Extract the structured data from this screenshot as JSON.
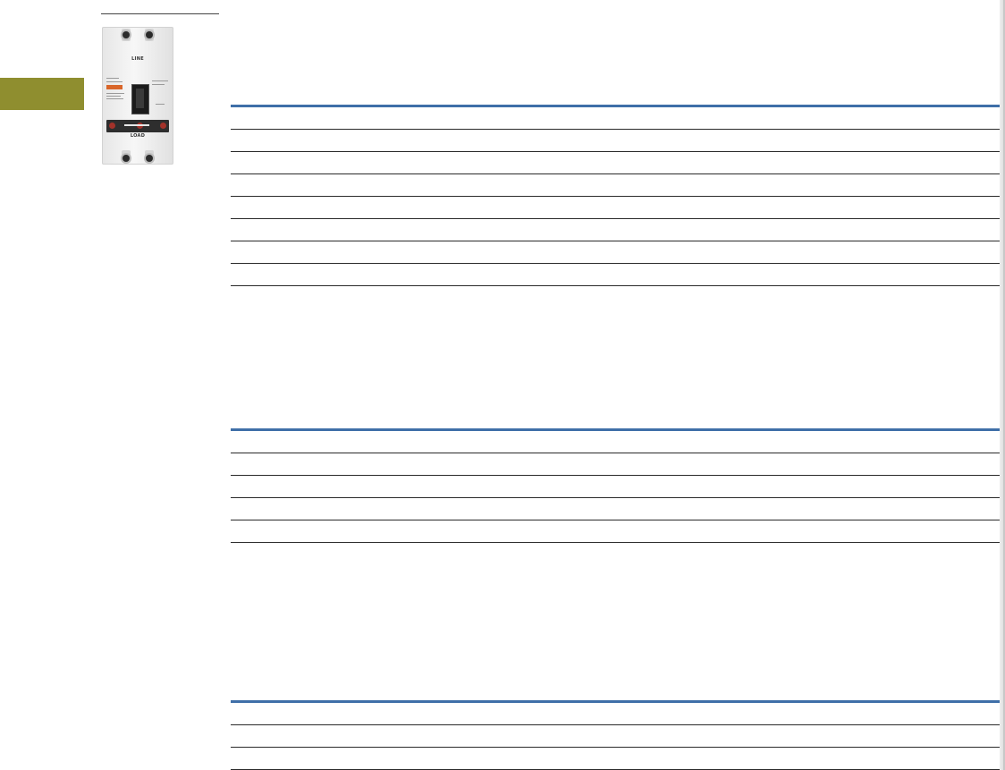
{
  "product_photo": {
    "line_label": "LINE",
    "load_label": "LOAD",
    "colors": {
      "brand_tag": "#d9662a",
      "handle": "#1b1b1b",
      "trip_unit": "#2e2e2e"
    }
  },
  "colors": {
    "section_tab": "#8f8e2f",
    "table_header_rule": "#3f6fa8",
    "row_divider": "#2a2a2a"
  },
  "tables": [
    {
      "rows": 8
    },
    {
      "rows": 5
    },
    {
      "rows": 3
    }
  ]
}
